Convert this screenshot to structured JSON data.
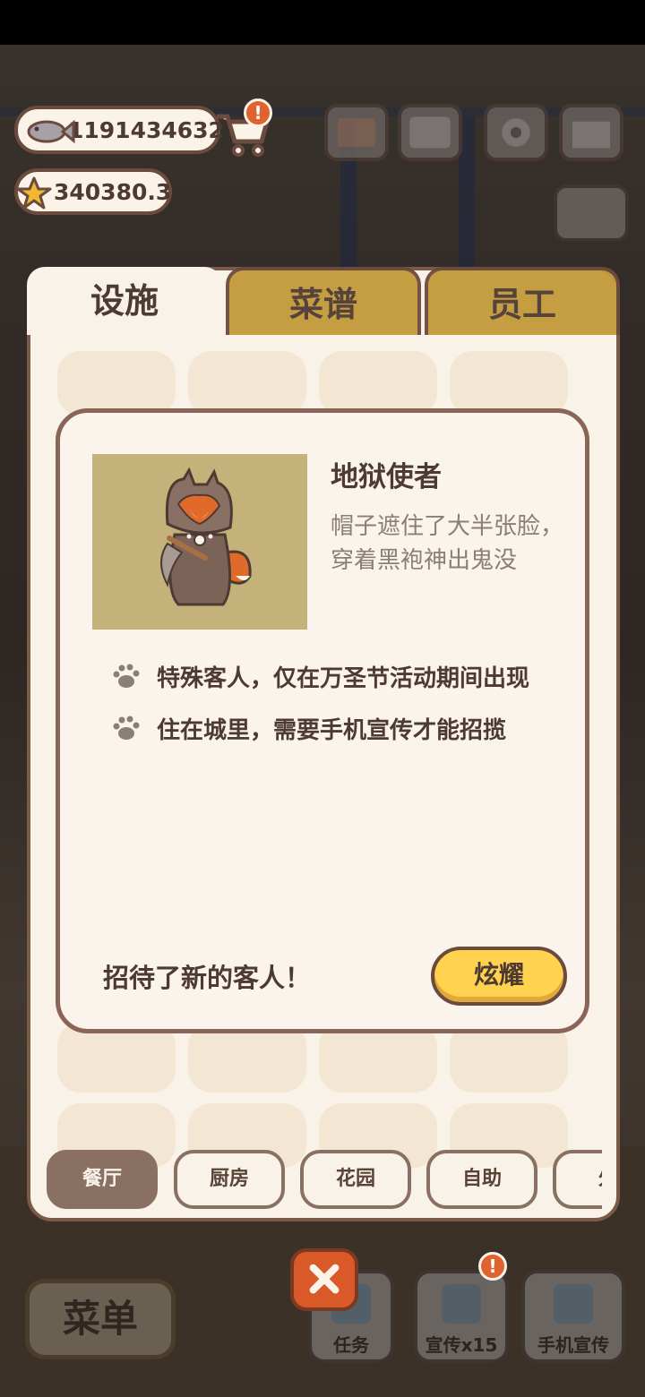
{
  "currency": {
    "fish": "1191434632",
    "stars": "340380.3"
  },
  "badges": {
    "cart_alert": "!",
    "promo_alert": "!"
  },
  "tabs": [
    {
      "label": "设施"
    },
    {
      "label": "菜谱"
    },
    {
      "label": "员工"
    }
  ],
  "dialog": {
    "name": "地狱使者",
    "description": "帽子遮住了大半张脸，穿着黑袍神出鬼没",
    "traits": [
      "特殊客人，仅在万圣节活动期间出现",
      "住在城里，需要手机宣传才能招揽"
    ],
    "new_guest_text": "招待了新的客人！",
    "show_button": "炫耀"
  },
  "categories": [
    {
      "label": "餐厅",
      "active": true
    },
    {
      "label": "厨房"
    },
    {
      "label": "花园"
    },
    {
      "label": "自助"
    },
    {
      "label": "外"
    }
  ],
  "hud": {
    "menu": "菜单",
    "task": "任务",
    "promo15": "宣传x15",
    "phone_promo": "手机宣传"
  },
  "colors": {
    "accent_yellow": "#ffd24f",
    "tab_gold": "#c49a3a",
    "panel_bg": "#f9f2e8",
    "border_brown": "#7a5a48",
    "alert_orange": "#e0622f"
  }
}
